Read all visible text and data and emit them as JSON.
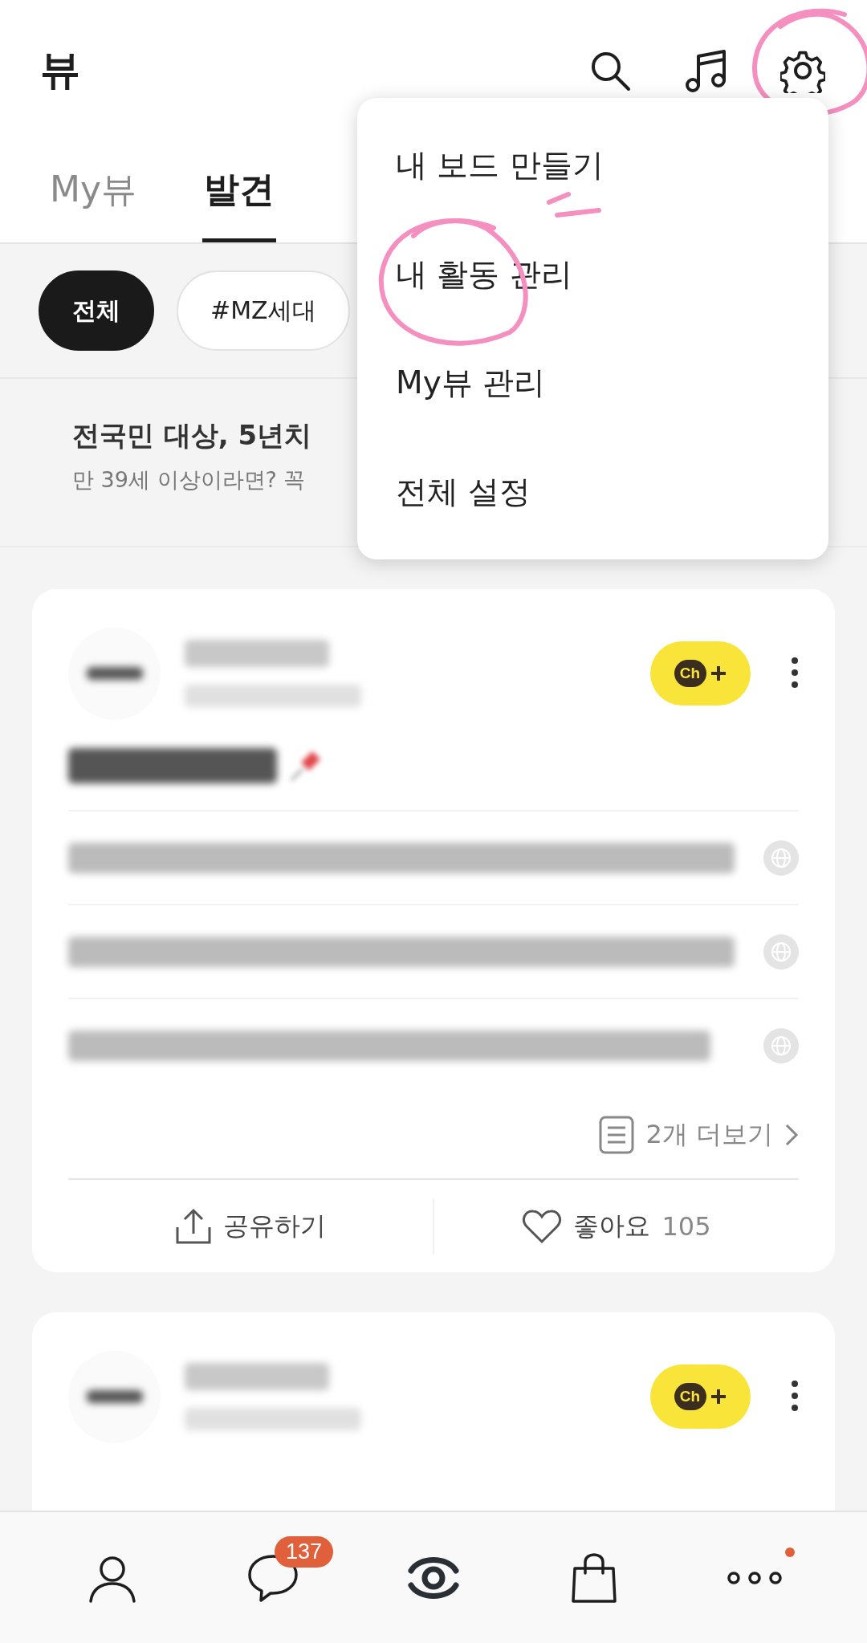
{
  "header": {
    "title": "뷰",
    "actions": [
      {
        "kind": "search",
        "circled": false
      },
      {
        "kind": "music",
        "circled": false
      },
      {
        "kind": "settings",
        "circled": true
      }
    ]
  },
  "tabs": [
    {
      "label": "My뷰",
      "selected": false
    },
    {
      "label": "발견",
      "selected": true
    }
  ],
  "chips": [
    {
      "label": "전체",
      "selected": true
    },
    {
      "label": "#MZ세대",
      "selected": false
    }
  ],
  "banner": {
    "title": "전국민 대상, 5년치",
    "subtitle": "만 39세 이상이라면? 꼭"
  },
  "menu": {
    "items": [
      {
        "label": "내 보드 만들기",
        "circled": false,
        "scribbled": true
      },
      {
        "label": "내 활동 관리",
        "circled": true,
        "scribbled": false
      },
      {
        "label": "My뷰 관리",
        "circled": false,
        "scribbled": false
      },
      {
        "label": "전체 설정",
        "circled": false,
        "scribbled": false
      }
    ]
  },
  "cards": [
    {
      "kind": "full",
      "channel_button": "Ch",
      "headlines": [
        {
          "kind": "blurred"
        },
        {
          "kind": "blurred"
        },
        {
          "kind": "blurred"
        }
      ],
      "more": "2개 더보기",
      "share": "공유하기",
      "like": "좋아요",
      "like_count": "105"
    },
    {
      "kind": "partial",
      "channel_button": "Ch"
    }
  ],
  "bottom_nav": [
    {
      "kind": "person",
      "selected": false
    },
    {
      "kind": "chat",
      "selected": false,
      "badge": "137"
    },
    {
      "kind": "view",
      "selected": true
    },
    {
      "kind": "shop",
      "selected": false
    },
    {
      "kind": "more",
      "selected": false,
      "dot": true
    }
  ]
}
